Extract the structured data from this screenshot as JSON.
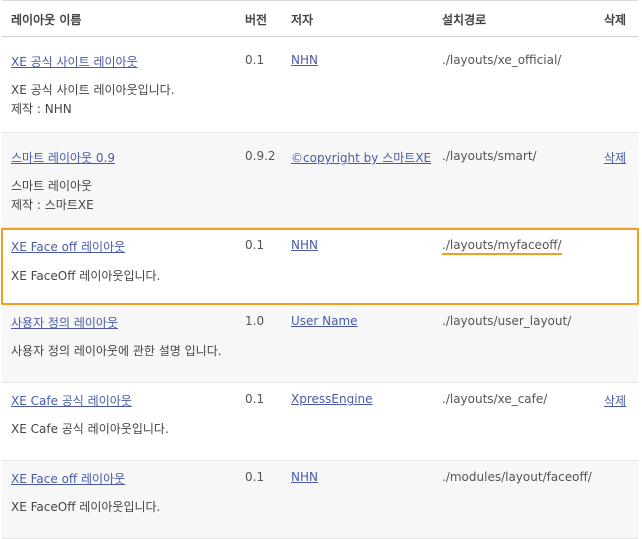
{
  "header": {
    "name": "레이아웃 이름",
    "version": "버전",
    "author": "저자",
    "path": "설치경로",
    "delete": "삭제"
  },
  "rows": [
    {
      "name": "XE 공식 사이트 레이아웃",
      "version": "0.1",
      "author": "NHN",
      "path": "./layouts/xe_official/",
      "delete": "",
      "desc1": "XE 공식 사이트 레이아웃입니다.",
      "desc2": "제작 : NHN"
    },
    {
      "name": "스마트 레이아웃 0.9",
      "version": "0.9.2",
      "author": "©copyright by 스마트XE",
      "path": "./layouts/smart/",
      "delete": "삭제",
      "desc1": "스마트 레이아웃",
      "desc2": "제작 : 스마트XE"
    },
    {
      "name": "XE Face off 레이아웃",
      "version": "0.1",
      "author": "NHN",
      "path": "./layouts/myfaceoff/",
      "delete": "",
      "desc1": "XE FaceOff 레이아웃입니다."
    },
    {
      "name": "사용자 정의 레이아웃",
      "version": "1.0",
      "author": "User Name",
      "path": "./layouts/user_layout/",
      "delete": "",
      "desc1": "사용자 정의 레이아웃에 관한 설명 입니다."
    },
    {
      "name": "XE Cafe 공식 레이아웃",
      "version": "0.1",
      "author": "XpressEngine",
      "path": "./layouts/xe_cafe/",
      "delete": "삭제",
      "desc1": "XE Cafe 공식 레이아웃입니다."
    },
    {
      "name": "XE Face off 레이아웃",
      "version": "0.1",
      "author": "NHN",
      "path": "./modules/layout/faceoff/",
      "delete": "",
      "desc1": "XE FaceOff 레이아웃입니다."
    }
  ]
}
